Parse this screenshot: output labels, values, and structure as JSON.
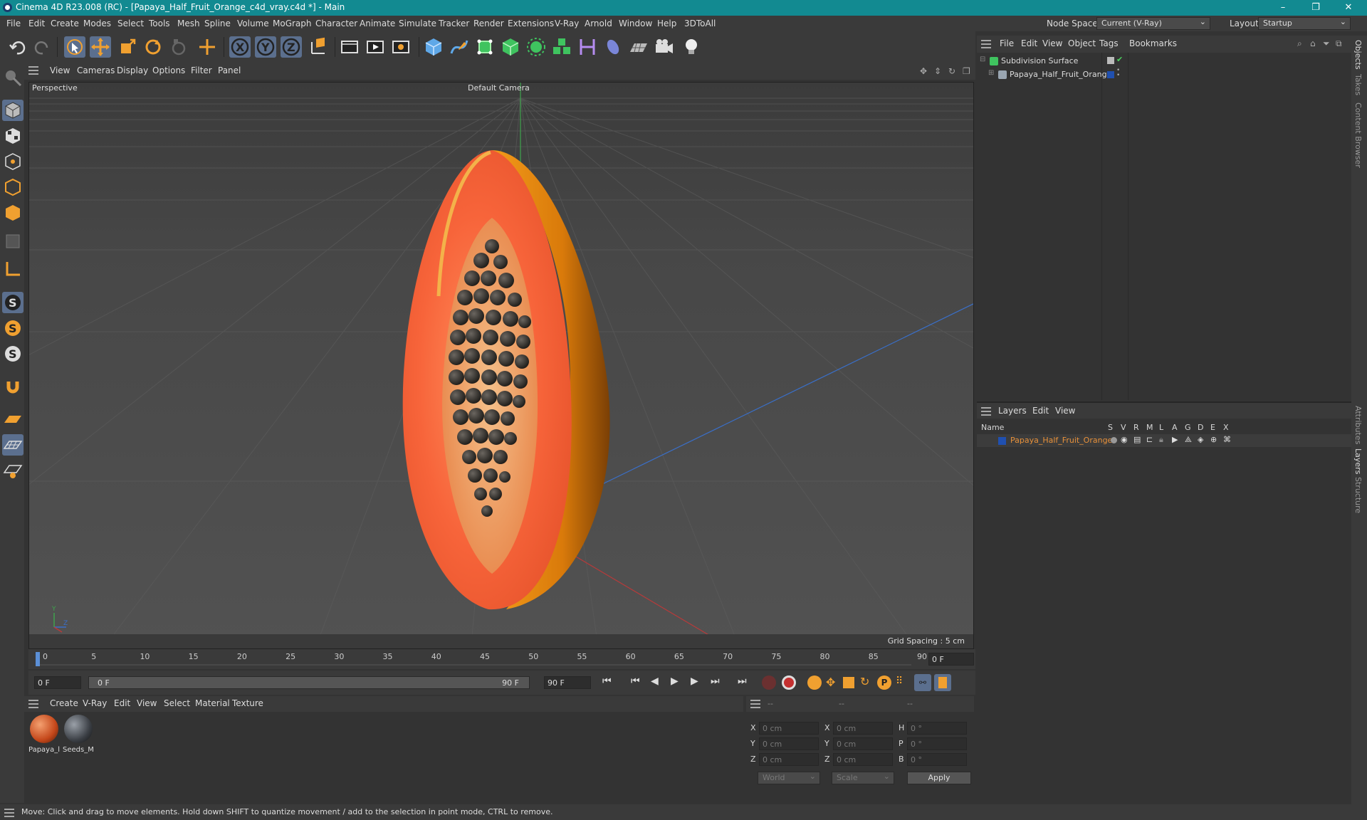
{
  "window": {
    "title": "Cinema 4D R23.008 (RC) - [Papaya_Half_Fruit_Orange_c4d_vray.c4d *] - Main",
    "minimize": "–",
    "restore": "❐",
    "close": "✕"
  },
  "menubar": {
    "items": [
      "File",
      "Edit",
      "Create",
      "Modes",
      "Select",
      "Tools",
      "Mesh",
      "Spline",
      "Volume",
      "MoGraph",
      "Character",
      "Animate",
      "Simulate",
      "Tracker",
      "Render",
      "Extensions",
      "V-Ray",
      "Arnold",
      "Window",
      "Help",
      "3DToAll"
    ],
    "node_space_label": "Node Space:",
    "node_space_value": "Current (V-Ray)",
    "layout_label": "Layout:",
    "layout_value": "Startup"
  },
  "viewport": {
    "menu": [
      "View",
      "Cameras",
      "Display",
      "Options",
      "Filter",
      "Panel"
    ],
    "label": "Perspective",
    "camera": "Default Camera",
    "grid_spacing": "Grid Spacing : 5 cm"
  },
  "objects": {
    "menu": [
      "File",
      "Edit",
      "View",
      "Object",
      "Tags",
      "Bookmarks"
    ],
    "items": [
      {
        "name": "Subdivision Surface"
      },
      {
        "name": "Papaya_Half_Fruit_Orange"
      }
    ]
  },
  "layers": {
    "menu": [
      "Layers",
      "Edit",
      "View"
    ],
    "columns": [
      "Name",
      "S",
      "V",
      "R",
      "M",
      "L",
      "A",
      "G",
      "D",
      "E",
      "X"
    ],
    "rows": [
      {
        "name": "Papaya_Half_Fruit_Orange"
      }
    ]
  },
  "side_tabs": [
    "Objects",
    "Takes",
    "Content Browser",
    "Attributes",
    "Layers",
    "Structure"
  ],
  "timeline": {
    "ticks": [
      "0",
      "5",
      "10",
      "15",
      "20",
      "25",
      "30",
      "35",
      "40",
      "45",
      "50",
      "55",
      "60",
      "65",
      "70",
      "75",
      "80",
      "85",
      "90"
    ],
    "current_frame": "0 F",
    "start_field": "0 F",
    "range_start": "0 F",
    "range_end": "90 F",
    "end_field": "90 F"
  },
  "materials": {
    "menu": [
      "Create",
      "V-Ray",
      "Edit",
      "View",
      "Select",
      "Material",
      "Texture"
    ],
    "items": [
      {
        "name": "Papaya_l",
        "color": "#c4471a"
      },
      {
        "name": "Seeds_M",
        "color": "#3b3f45"
      }
    ]
  },
  "coords": {
    "headers": [
      "--",
      "--",
      "--"
    ],
    "rows": [
      {
        "a": "X",
        "av": "0 cm",
        "b": "X",
        "bv": "0 cm",
        "c": "H",
        "cv": "0 °"
      },
      {
        "a": "Y",
        "av": "0 cm",
        "b": "Y",
        "bv": "0 cm",
        "c": "P",
        "cv": "0 °"
      },
      {
        "a": "Z",
        "av": "0 cm",
        "b": "Z",
        "bv": "0 cm",
        "c": "B",
        "cv": "0 °"
      }
    ],
    "world": "World",
    "scale": "Scale",
    "apply": "Apply"
  },
  "status": "Move: Click and drag to move elements. Hold down SHIFT to quantize movement / add to the selection in point mode, CTRL to remove.",
  "colors": {
    "titlebar": "#128a91",
    "accent": "#f0a030",
    "layer_text": "#e8913a",
    "selection": "#5b6f8e"
  }
}
